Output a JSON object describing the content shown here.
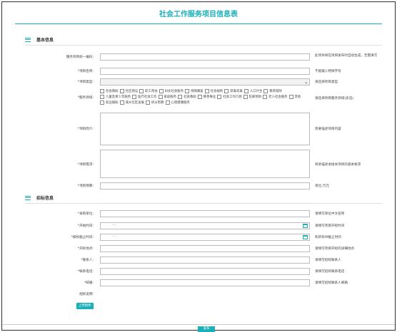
{
  "title": "社会工作服务项目信息表",
  "basic": {
    "section_title": "基本信息",
    "code_label": "服务项目统一编码:",
    "code_hint": "此项条将在项目发布时自动生成，无需填写",
    "name_label": "*项目名称:",
    "name_hint": "不能输入特殊字符",
    "type_label": "*项目类型:",
    "type_hint": "请选择项目类型",
    "field_label": "*服务领域:",
    "field_hint": "请选择项目服务领域(多选)",
    "field_options": [
      "社会救助",
      "社区建设",
      "职工帮扶",
      "妇女社会服务",
      "残障康复",
      "社会福利",
      "禁毒戒毒",
      "人口计生",
      "教育辅导",
      "儿童及青少年服务",
      "医疗社会工作",
      "家庭服务",
      "社会救助",
      "慈善事业",
      "社会工作行政",
      "犯罪预防",
      "老人社会服务",
      "其他",
      "就业援助",
      "城乡社区发展",
      "拆分帮教",
      "心理健康服务"
    ],
    "intro_label": "*项目简介:",
    "intro_hint": "简要描述项目内容",
    "need_label": "*项目需求:",
    "need_hint": "简单描述承接本项目的基本要求",
    "budget_label": "*项目预算:",
    "budget_hint": "单位:万元"
  },
  "bid": {
    "section_title": "招标信息",
    "buyer_label": "*采购单位:",
    "buyer_hint": "请填写单位中文名称",
    "start_label": "*开始时间:",
    "start_value": "-   -",
    "start_hint": "请填写项目开标时间",
    "deadline_label": "*报标截止时间:",
    "deadline_value": "-   -",
    "deadline_hint": "购买标书截止时间",
    "place_label": "*开标地点:",
    "place_hint": "请填写项目开标的详细地点",
    "contact_label": "*联系人:",
    "contact_hint": "请填写招标联系人",
    "phone_label": "*联系电话:",
    "phone_hint": "请填写招标联系电话",
    "email_label": "*邮箱:",
    "email_hint": "请填写招标联系人邮箱",
    "desc_label": "招标说明:",
    "upload_label": "上传附件"
  },
  "submit_label": "发布",
  "colors": {
    "accent": "#1ab0b8"
  }
}
